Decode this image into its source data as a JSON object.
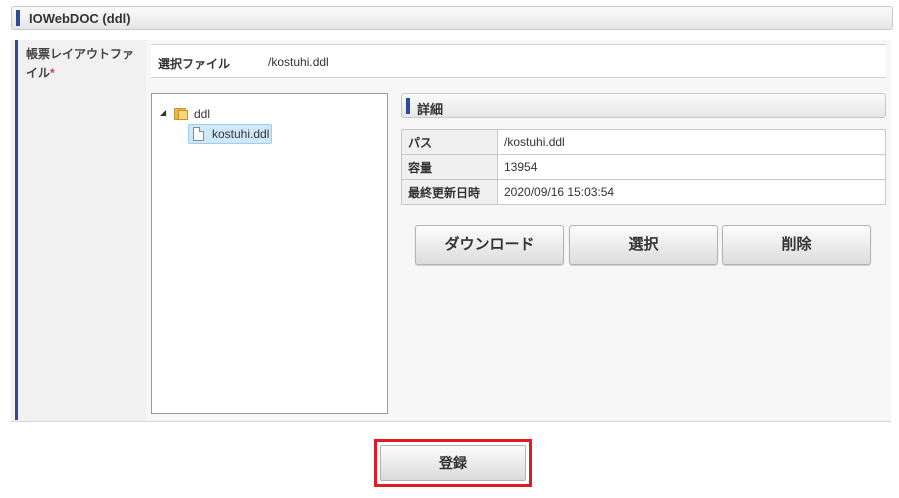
{
  "header": {
    "title": "IOWebDOC (ddl)"
  },
  "form": {
    "label": "帳票レイアウトファイル",
    "required_mark": "*",
    "selected_file_label": "選択ファイル",
    "selected_file_value": "/kostuhi.ddl"
  },
  "tree": {
    "folder": {
      "label": "ddl",
      "icon": "folder-icon",
      "expanded": true
    },
    "file": {
      "label": "kostuhi.ddl",
      "icon": "file-icon",
      "selected": true
    }
  },
  "detail": {
    "title": "詳細",
    "rows": [
      {
        "key": "パス",
        "value": "/kostuhi.ddl"
      },
      {
        "key": "容量",
        "value": "13954"
      },
      {
        "key": "最終更新日時",
        "value": "2020/09/16 15:03:54"
      }
    ]
  },
  "buttons": {
    "download": "ダウンロード",
    "select": "選択",
    "delete": "削除"
  },
  "submit": {
    "label": "登録"
  },
  "colors": {
    "accent": "#2d4a9c",
    "highlight_border": "#e01b24",
    "selection_bg": "#cfe8fa"
  }
}
